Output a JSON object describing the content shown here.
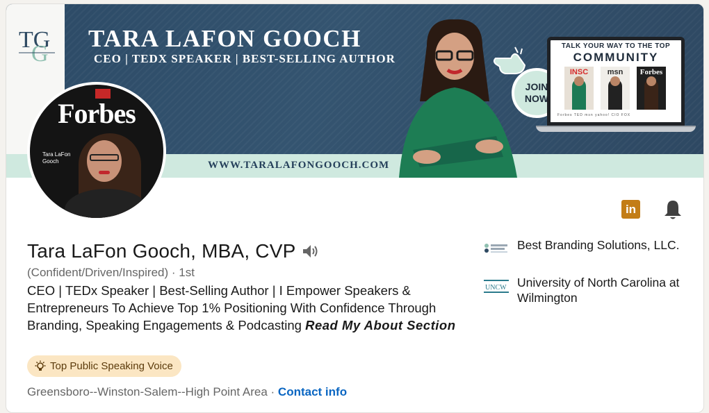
{
  "banner": {
    "logo_text": "TG",
    "name": "TARA LAFON GOOCH",
    "tagline": "CEO | TEDX SPEAKER | BEST-SELLING AUTHOR",
    "url": "WWW.TARALAFONGOOCH.COM",
    "join_label_1": "JOIN",
    "join_label_2": "NOW",
    "laptop_heading": "TALK YOUR WAY TO THE TOP",
    "laptop_subheading": "COMMUNITY",
    "magazines": [
      "INSC",
      "msn",
      "Forbes"
    ],
    "logos_row": "Forbes TED msn yahoo! CIO FOX"
  },
  "avatar": {
    "magazine_title": "Forbes",
    "caption_line1": "Tara LaFon",
    "caption_line2": "Gooch"
  },
  "actions": {
    "linkedin_label": "in"
  },
  "profile": {
    "name": "Tara LaFon Gooch, MBA, CVP",
    "pronouns": "(Confident/Driven/Inspired)",
    "connection_degree": "· 1st",
    "headline_plain": "CEO | TEDx Speaker | Best-Selling Author | I Empower Speakers & Entrepreneurs To Achieve Top 1% Positioning With Confidence Through Branding, Speaking Engagements & Podcasting ",
    "headline_emphasis": "Read My About Section",
    "badge": "Top Public Speaking Voice",
    "location": "Greensboro--Winston-Salem--High Point Area",
    "separator": " · ",
    "contact_info": "Contact info"
  },
  "orgs": [
    {
      "name": "Best Branding Solutions, LLC.",
      "logo": "best-branding-logo"
    },
    {
      "name": "University of North Carolina at Wilmington",
      "logo": "uncw-logo"
    }
  ],
  "colors": {
    "banner_navy": "#2f4a62",
    "mint": "#cfe9df",
    "link_blue": "#0a66c2",
    "linkedin_gold": "#c37d16",
    "badge_bg": "#fbe6c3"
  },
  "icons": [
    "speaker-icon",
    "linkedin-icon",
    "bell-icon",
    "bulb-icon",
    "hand-pointer-icon"
  ]
}
